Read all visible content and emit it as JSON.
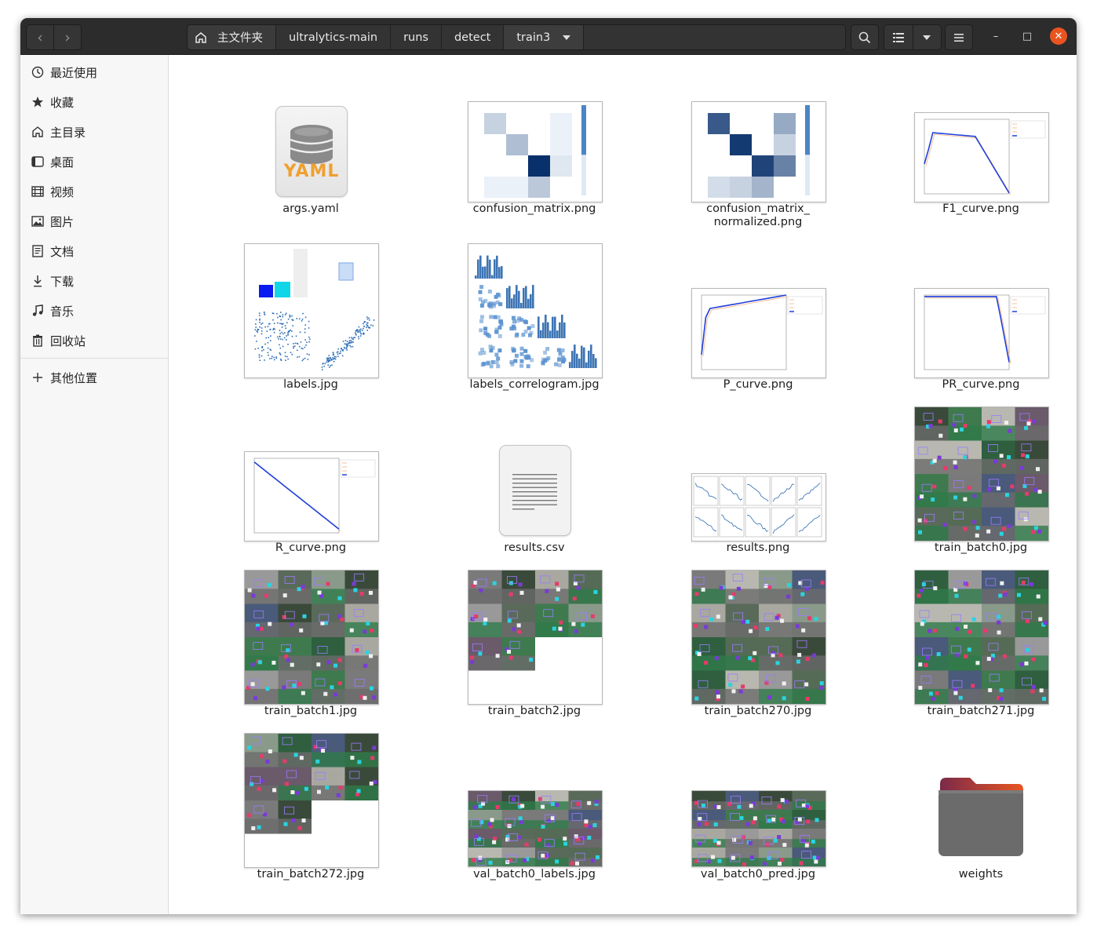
{
  "window": {
    "breadcrumbs": [
      "主文件夹",
      "ultralytics-main",
      "runs",
      "detect",
      "train3"
    ],
    "controls": {
      "minimize": "–",
      "maximize": "□",
      "close": "✕"
    }
  },
  "sidebar": {
    "items": [
      {
        "label": "最近使用",
        "icon": "clock-icon"
      },
      {
        "label": "收藏",
        "icon": "star-icon"
      },
      {
        "label": "主目录",
        "icon": "home-icon"
      },
      {
        "label": "桌面",
        "icon": "desktop-icon"
      },
      {
        "label": "视频",
        "icon": "video-icon"
      },
      {
        "label": "图片",
        "icon": "image-icon"
      },
      {
        "label": "文档",
        "icon": "document-icon"
      },
      {
        "label": "下载",
        "icon": "download-icon"
      },
      {
        "label": "音乐",
        "icon": "music-icon"
      },
      {
        "label": "回收站",
        "icon": "trash-icon"
      }
    ],
    "other": {
      "label": "其他位置",
      "icon": "plus-icon"
    }
  },
  "files": [
    {
      "name": "args.yaml",
      "kind": "yaml",
      "badge": "YAML"
    },
    {
      "name": "confusion_matrix.png",
      "kind": "cm"
    },
    {
      "name": "confusion_matrix_\nnormalized.png",
      "kind": "cmn"
    },
    {
      "name": "F1_curve.png",
      "kind": "curve"
    },
    {
      "name": "labels.jpg",
      "kind": "labels"
    },
    {
      "name": "labels_correlogram.jpg",
      "kind": "corr"
    },
    {
      "name": "P_curve.png",
      "kind": "curve"
    },
    {
      "name": "PR_curve.png",
      "kind": "curve"
    },
    {
      "name": "R_curve.png",
      "kind": "curve"
    },
    {
      "name": "results.csv",
      "kind": "csv"
    },
    {
      "name": "results.png",
      "kind": "results"
    },
    {
      "name": "train_batch0.jpg",
      "kind": "photos"
    },
    {
      "name": "train_batch1.jpg",
      "kind": "photos"
    },
    {
      "name": "train_batch2.jpg",
      "kind": "photos"
    },
    {
      "name": "train_batch270.jpg",
      "kind": "photos"
    },
    {
      "name": "train_batch271.jpg",
      "kind": "photos"
    },
    {
      "name": "train_batch272.jpg",
      "kind": "photos"
    },
    {
      "name": "val_batch0_labels.jpg",
      "kind": "photos"
    },
    {
      "name": "val_batch0_pred.jpg",
      "kind": "photos"
    },
    {
      "name": "weights",
      "kind": "folder"
    }
  ],
  "colors": {
    "accent": "#e95420",
    "headerbar": "#2c2c2c",
    "folder": "#6b6b6b"
  }
}
